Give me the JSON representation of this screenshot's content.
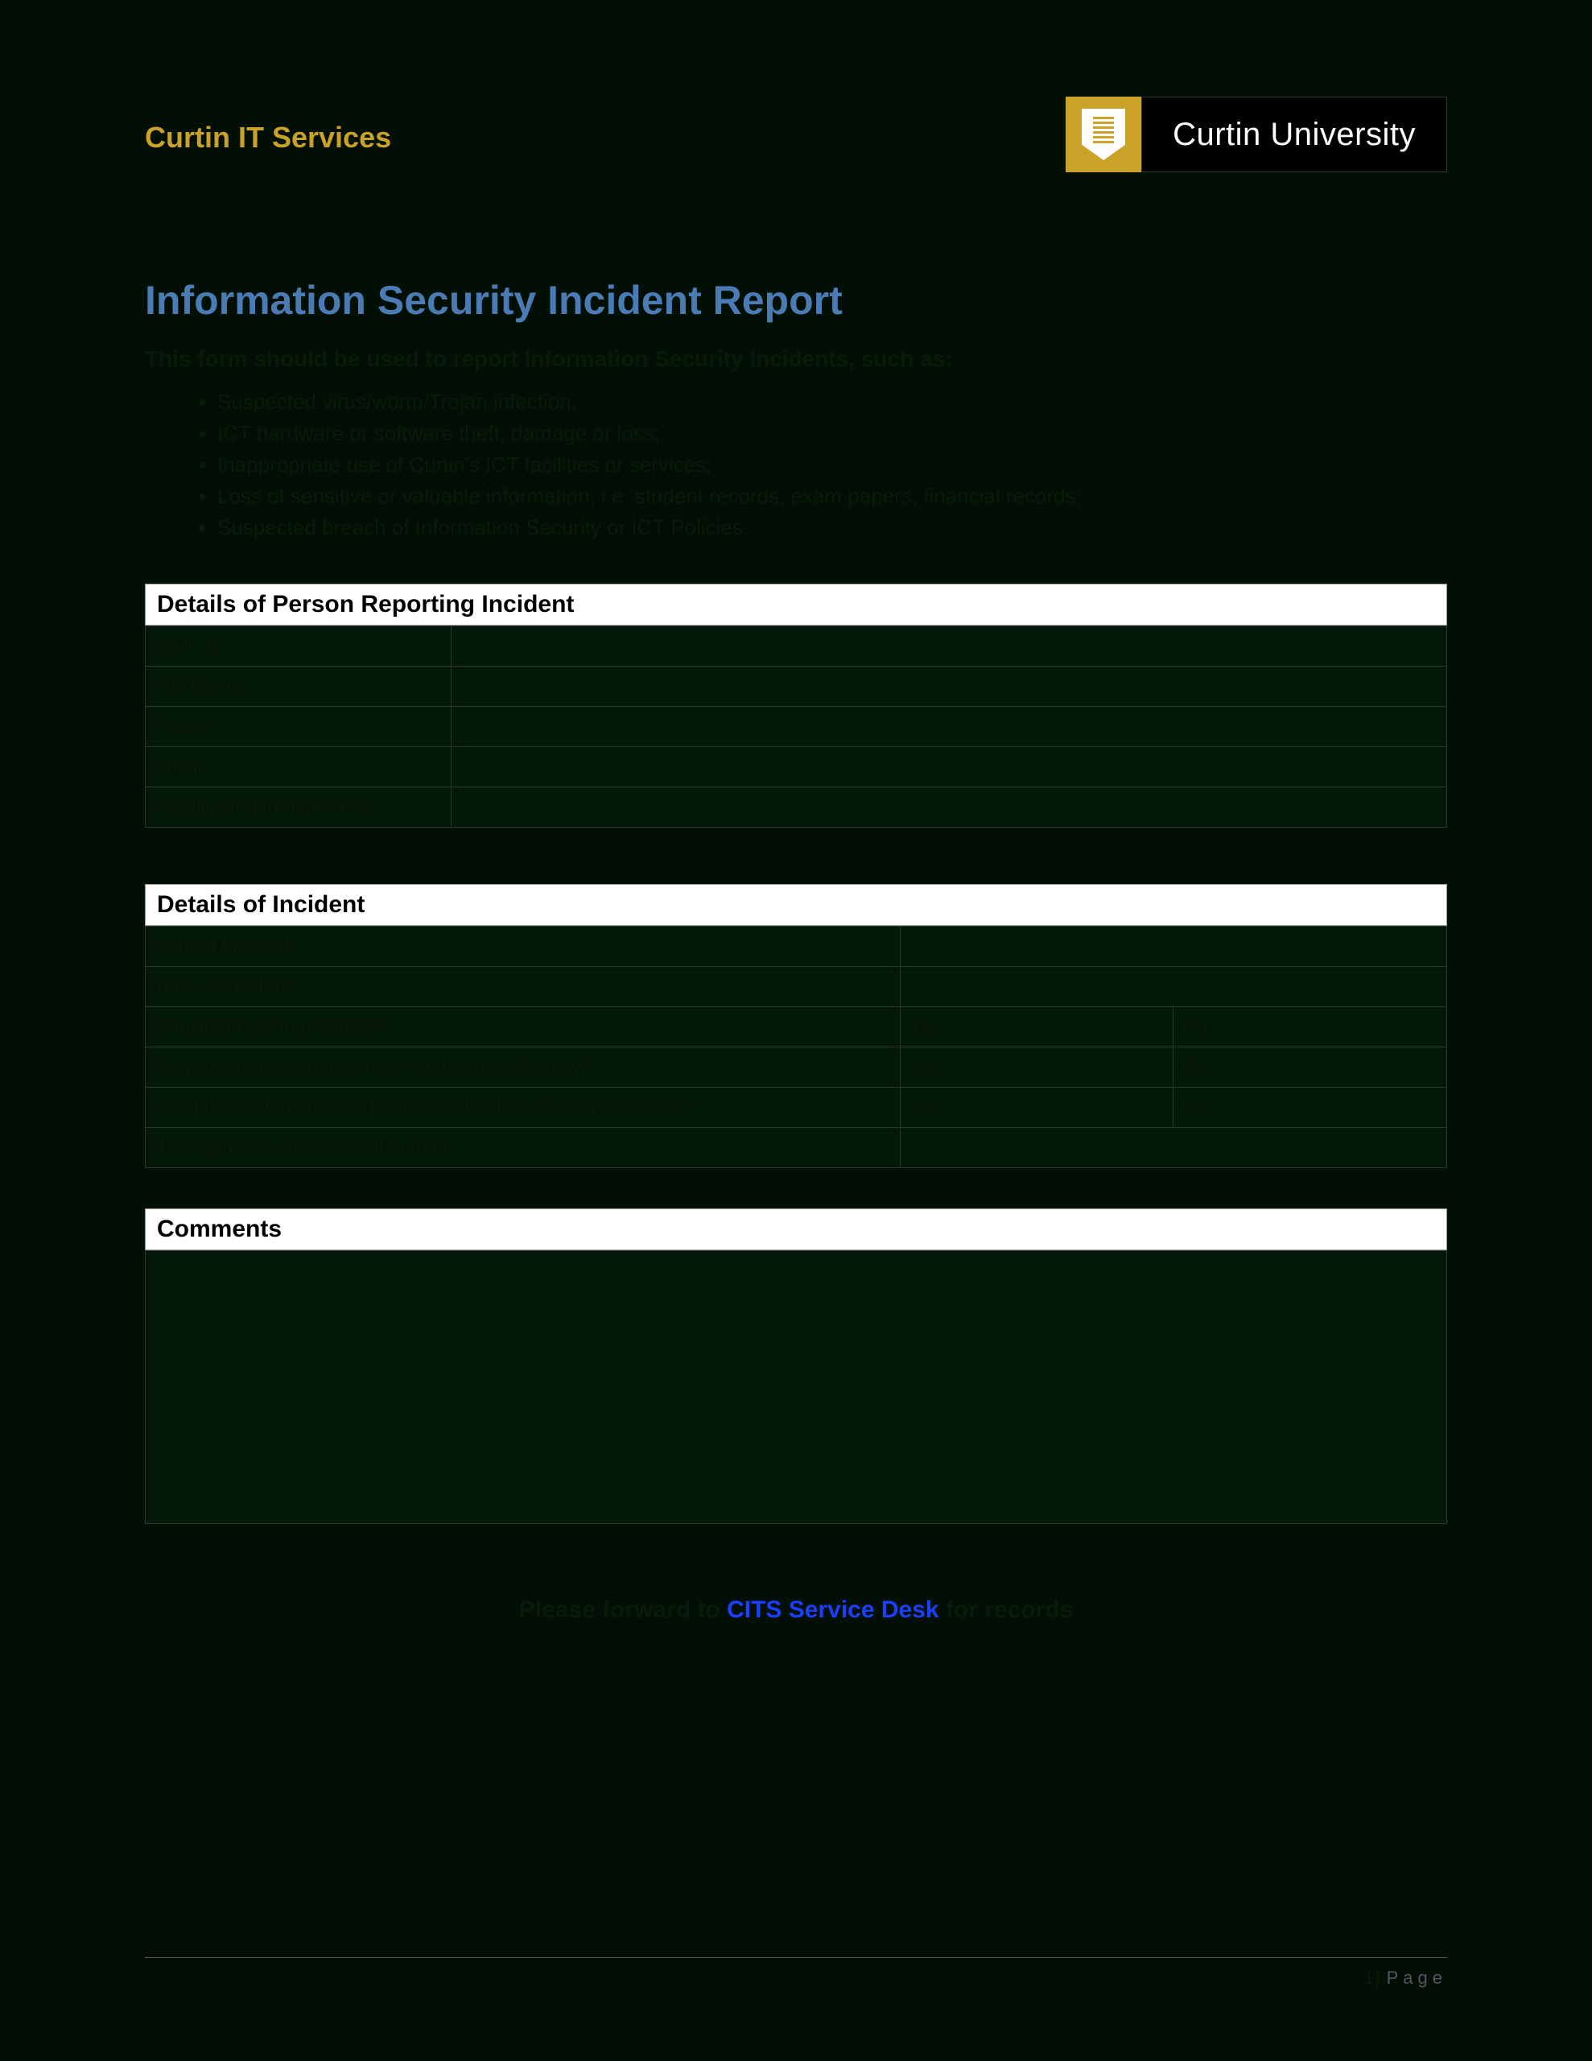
{
  "header": {
    "department": "Curtin IT Services",
    "university": "Curtin University"
  },
  "title": "Information Security Incident Report",
  "intro": "This form should be used to report Information Security Incidents, such as:",
  "bullets": [
    "Suspected virus/worm/Trojan infection;",
    "ICT hardware or software theft, damage or loss;",
    "Inappropriate use of Curtin's ICT facilities or services;",
    "Loss of sensitive or valuable information, i.e. student records, exam papers, financial records;",
    "Suspected breach of Information Security or ICT Policies"
  ],
  "sections": {
    "reporter": {
      "heading": "Details of Person Reporting Incident",
      "fields": [
        "Staff ID:",
        "Full Name:",
        "Phone:",
        "Email:",
        "Faculty/Department/Area:"
      ]
    },
    "incident": {
      "heading": "Details of Incident",
      "date_label": "Date of Incident:",
      "time_label": "Time of Incident:",
      "questions": [
        "Is Incident still in progress?",
        "Do you need assistance from Information Security?",
        "Has this Incident already been reported to CITS Service Desk?"
      ],
      "yes": "Yes",
      "no": "No",
      "service_call_label": "If Yes, provide Service Call number:"
    },
    "comments": {
      "heading": "Comments"
    }
  },
  "forward": {
    "pre": "Please forward to ",
    "link": "CITS Service Desk",
    "post": " for records"
  },
  "footer": {
    "page_num": "1|",
    "page_word": "Page"
  }
}
